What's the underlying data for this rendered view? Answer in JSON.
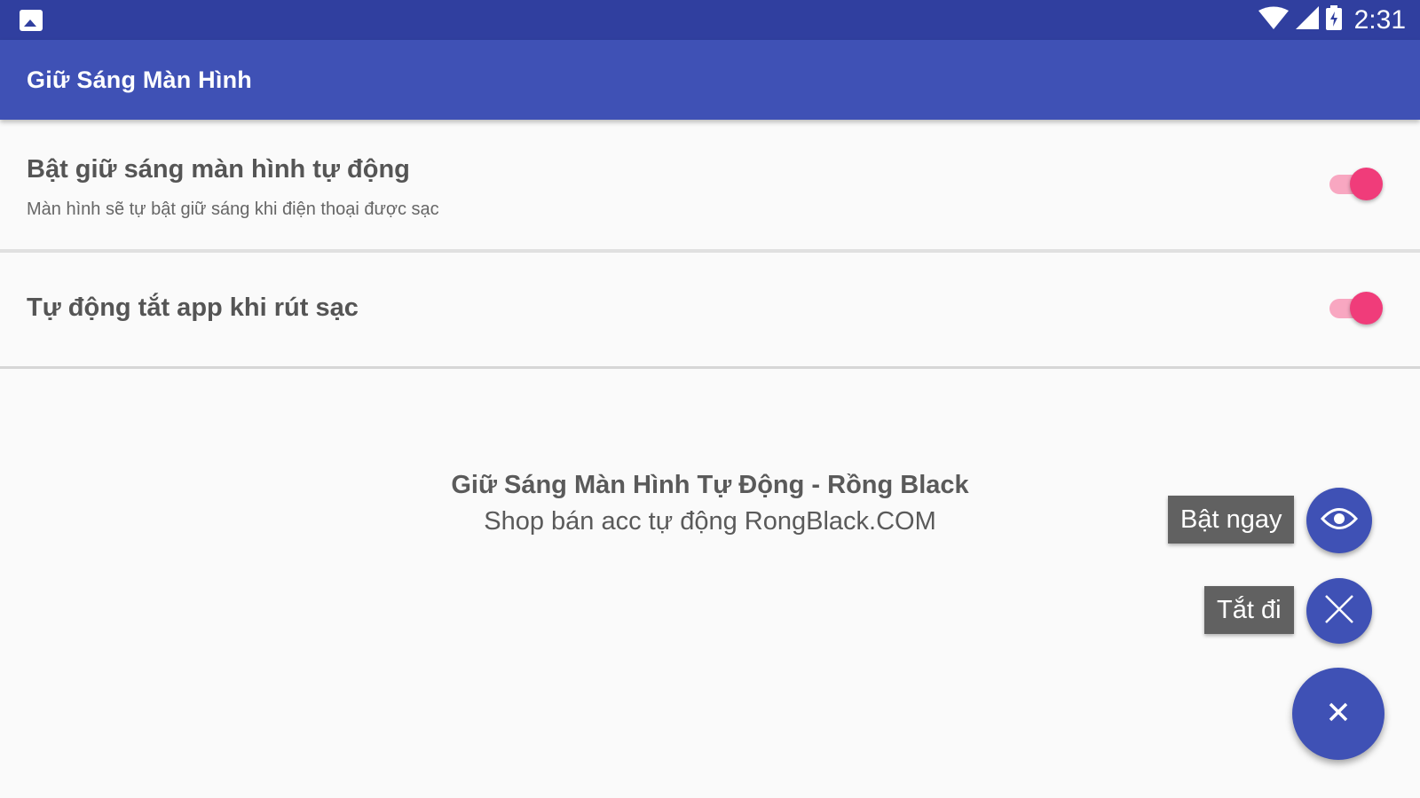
{
  "status_bar": {
    "left_icon": "gallery-icon",
    "icons": [
      "wifi-icon",
      "signal-icon",
      "battery-charging-icon"
    ],
    "time": "2:31"
  },
  "app_bar": {
    "title": "Giữ Sáng Màn Hình"
  },
  "settings": [
    {
      "title": "Bật giữ sáng màn hình tự động",
      "subtitle": "Màn hình sẽ tự bật giữ sáng khi điện thoại được sạc",
      "enabled": true
    },
    {
      "title": "Tự động tắt app khi rút sạc",
      "enabled": true
    }
  ],
  "center": {
    "title": "Giữ Sáng Màn Hình Tự Động - Rồng Black",
    "subtitle": "Shop bán acc tự động RongBlack.COM"
  },
  "fab_menu": {
    "actions": [
      {
        "label": "Bật ngay",
        "icon": "eye-icon"
      },
      {
        "label": "Tắt đi",
        "icon": "close-icon"
      }
    ],
    "main_icon": "close-icon"
  },
  "colors": {
    "status_bar": "#303f9f",
    "app_bar": "#3f51b5",
    "accent": "#f03c7a",
    "fab": "#3f51b5"
  }
}
